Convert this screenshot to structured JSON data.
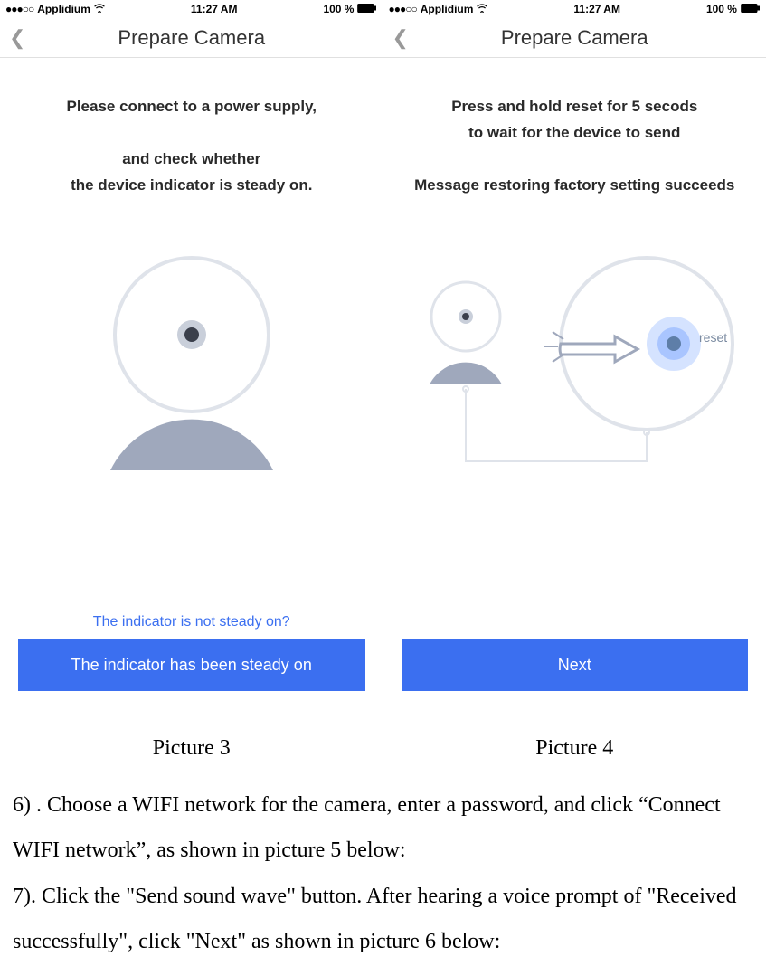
{
  "status_bar": {
    "carrier": "Applidium",
    "time": "11:27 AM",
    "battery": "100 %"
  },
  "nav": {
    "title": "Prepare Camera"
  },
  "screen1": {
    "line1": "Please connect to a power supply,",
    "line2": "and check whether",
    "line3": "the device indicator is steady on.",
    "help_link": "The indicator is not steady on?",
    "button": "The indicator has been steady on"
  },
  "screen2": {
    "line1": "Press and hold reset for 5 secods",
    "line2": "to wait for the device to send",
    "line3": "Message restoring factory setting succeeds",
    "reset_label": "reset",
    "button": "Next"
  },
  "captions": {
    "p3": "Picture 3",
    "p4": "Picture 4"
  },
  "body": {
    "step6": "6) . Choose a WIFI network for the camera, enter a password, and click “Connect WIFI network”, as shown in picture 5 below:",
    "step7": "7). Click the \"Send sound wave\" button. After hearing a voice prompt of \"Received successfully\", click \"Next\" as shown in picture 6 below:"
  }
}
